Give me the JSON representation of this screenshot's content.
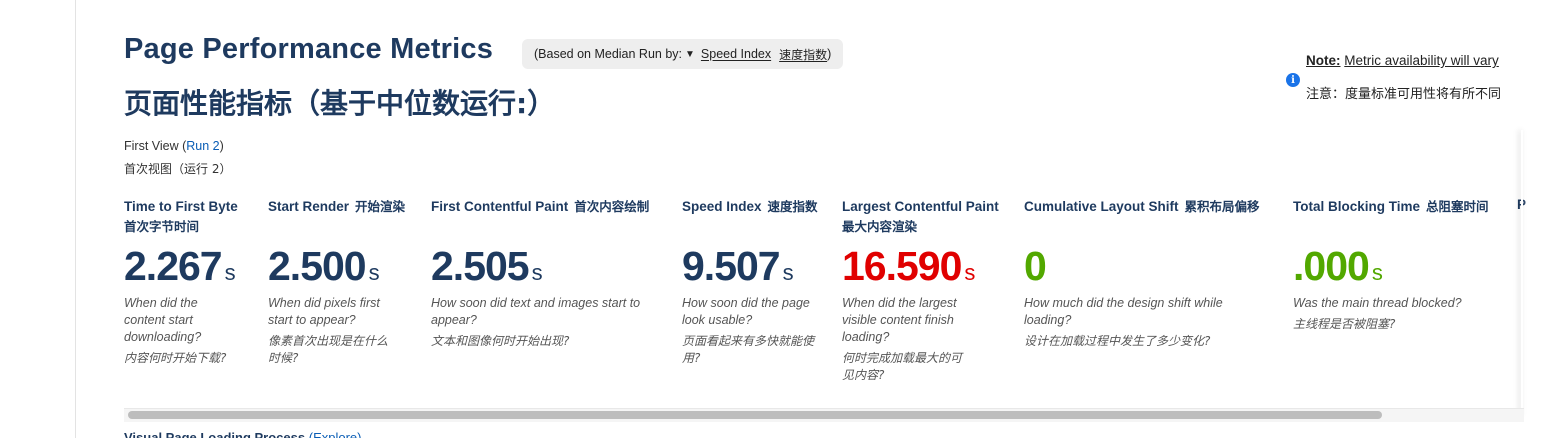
{
  "header": {
    "title_en": "Page Performance Metrics",
    "title_zh": "页面性能指标（基于中位数运行:）",
    "median_prefix": "(Based on Median Run by:",
    "median_caret": "▼",
    "median_selected": "Speed Index",
    "median_selected_zh": "速度指数",
    "median_suffix": ")"
  },
  "note": {
    "label": "Note:",
    "text": "Metric availability will vary",
    "text_zh": "注意：度量标准可用性将有所不同",
    "icon": "info-icon"
  },
  "view": {
    "label": "First View (",
    "run_link": "Run 2",
    "close": ")",
    "label_zh": "首次视图（运行 2）"
  },
  "metrics": [
    {
      "label": "Time to First Byte",
      "label_zh": "首次字节时间",
      "value": "2.267",
      "unit": "s",
      "desc": "When did the content start downloading?",
      "desc_zh": "内容何时开始下载?"
    },
    {
      "label": "Start Render",
      "label_zh": "开始渲染",
      "value": "2.500",
      "unit": "s",
      "desc": "When did pixels first start to appear?",
      "desc_zh": "像素首次出现是在什么时候?"
    },
    {
      "label": "First Contentful Paint",
      "label_zh": "首次内容绘制",
      "value": "2.505",
      "unit": "s",
      "desc": "How soon did text and images start to appear?",
      "desc_zh": "文本和图像何时开始出现?"
    },
    {
      "label": "Speed Index",
      "label_zh": "速度指数",
      "value": "9.507",
      "unit": "s",
      "desc": "How soon did the page look usable?",
      "desc_zh": "页面看起来有多快就能使用?"
    },
    {
      "label": "Largest Contentful Paint",
      "label_zh": "最大内容渲染",
      "value": "16.590",
      "unit": "s",
      "desc": "When did the largest visible content finish loading?",
      "desc_zh": "何时完成加载最大的可见内容?"
    },
    {
      "label": "Cumulative Layout Shift",
      "label_zh": "累积布局偏移",
      "value": "0",
      "unit": "",
      "desc": "How much did the design shift while loading?",
      "desc_zh": "设计在加载过程中发生了多少变化?"
    },
    {
      "label": "Total Blocking Time",
      "label_zh": "总阻塞时间",
      "value": ".000",
      "unit": "s",
      "desc": "Was the main thread blocked?",
      "desc_zh": "主线程是否被阻塞?"
    }
  ],
  "cut_col_label": "P",
  "bottom": {
    "label": "Visual Page Loading Process",
    "link": "(Explore)"
  },
  "colors": {
    "heading": "#1e3a5f",
    "poor": "#e00000",
    "good": "#52a800",
    "link": "#0a5db5"
  }
}
